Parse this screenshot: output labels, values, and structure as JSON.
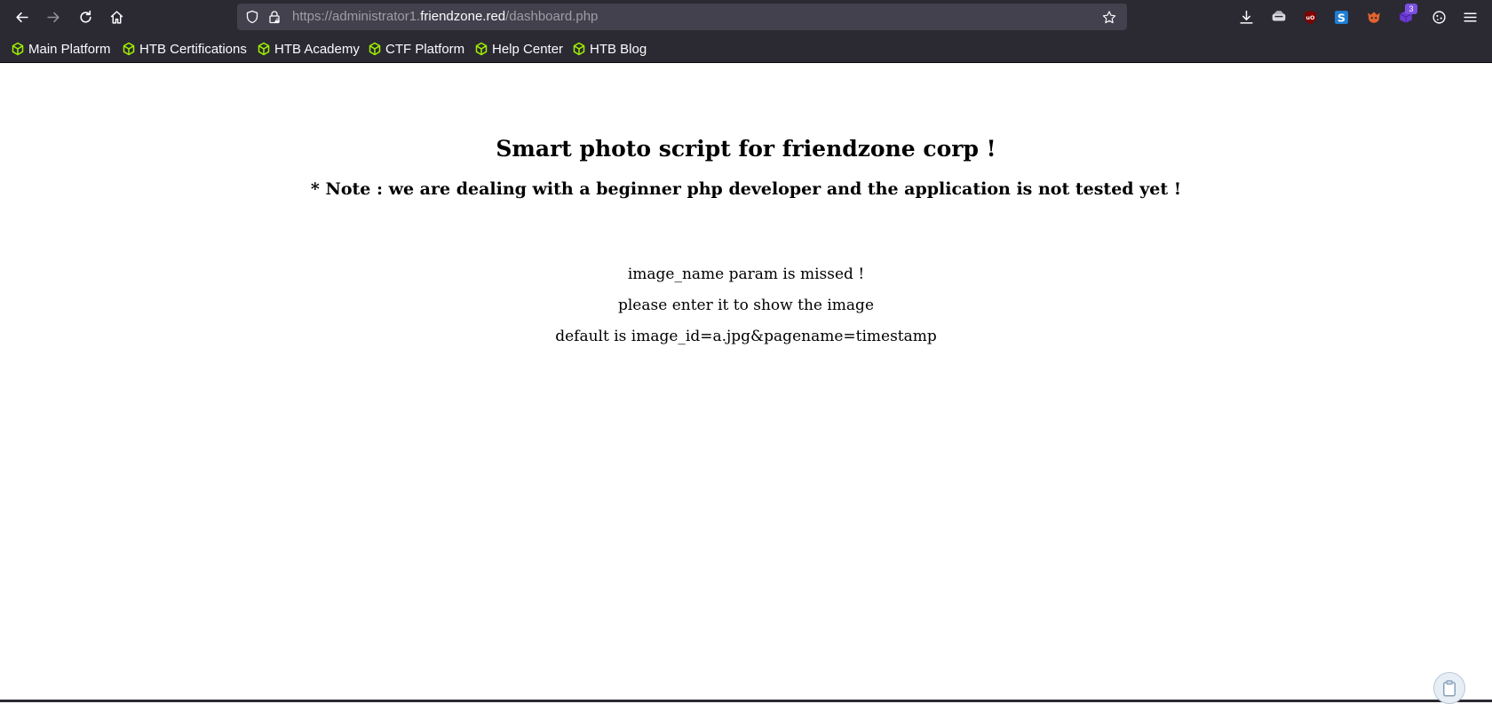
{
  "browser": {
    "url_scheme": "https://administrator1.",
    "url_host": "friendzone.red",
    "url_path": "/dashboard.php",
    "extension_badge": "3"
  },
  "bookmarks": [
    {
      "label": "Main Platform",
      "icon": "htb-cube-icon"
    },
    {
      "label": "HTB Certifications",
      "icon": "htb-cube-icon"
    },
    {
      "label": "HTB Academy",
      "icon": "htb-cube-icon"
    },
    {
      "label": "CTF Platform",
      "icon": "htb-cube-icon"
    },
    {
      "label": "Help Center",
      "icon": "htb-cube-icon"
    },
    {
      "label": "HTB Blog",
      "icon": "htb-cube-icon"
    }
  ],
  "page": {
    "title": "Smart photo script for friendzone corp !",
    "note": "* Note : we are dealing with a beginner php developer and the application is not tested yet !",
    "messages": [
      "image_name param is missed !",
      "please enter it to show the image",
      "default is image_id=a.jpg&pagename=timestamp"
    ]
  },
  "colors": {
    "chrome": "#2b2a33",
    "urlbar": "#42414d",
    "bookmark_icon": "#9fef00",
    "page_bg": "#ffffff"
  }
}
